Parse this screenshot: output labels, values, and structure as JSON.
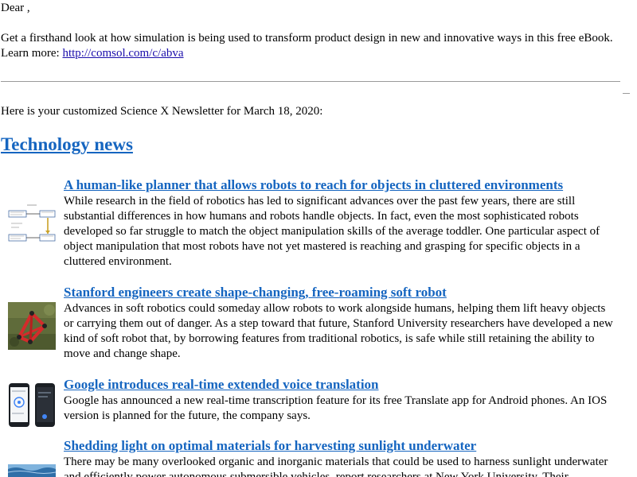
{
  "greeting": "Dear ,",
  "promo": {
    "text": "Get a firsthand look at how simulation is being used to transform product design in new and innovative ways in this free eBook.",
    "learn_more": "Learn more:",
    "link": "http://comsol.com/c/abva"
  },
  "intro": "Here is your customized Science X Newsletter for March 18, 2020:",
  "section": {
    "title": "Technology news"
  },
  "articles": [
    {
      "headline": "A human-like planner that allows robots to reach for objects in cluttered environments",
      "summary": "While research in the field of robotics has led to significant advances over the past few years, there are still substantial differences in how humans and robots handle objects. In fact, even the most sophisticated robots developed so far struggle to match the object manipulation skills of the average toddler. One particular aspect of object manipulation that most robots have not yet mastered is reaching and grasping for specific objects in a cluttered environment.",
      "thumb": "diagram"
    },
    {
      "headline": "Stanford engineers create shape-changing, free-roaming soft robot",
      "summary": "Advances in soft robotics could someday allow robots to work alongside humans, helping them lift heavy objects or carrying them out of danger. As a step toward that future, Stanford University researchers have developed a new kind of soft robot that, by borrowing features from traditional robotics, is safe while still retaining the ability to move and change shape.",
      "thumb": "robot-photo"
    },
    {
      "headline": "Google introduces real-time extended voice translation",
      "summary": "Google has announced a new real-time transcription feature for its free Translate app for Android phones. An IOS version is planned for the future, the company says.",
      "thumb": "phones"
    },
    {
      "headline": "Shedding light on optimal materials for harvesting sunlight underwater",
      "summary": "There may be many overlooked organic and inorganic materials that could be used to harness sunlight underwater and efficiently power autonomous submersible vehicles, report researchers at New York University. Their",
      "thumb": "water-photo"
    }
  ]
}
